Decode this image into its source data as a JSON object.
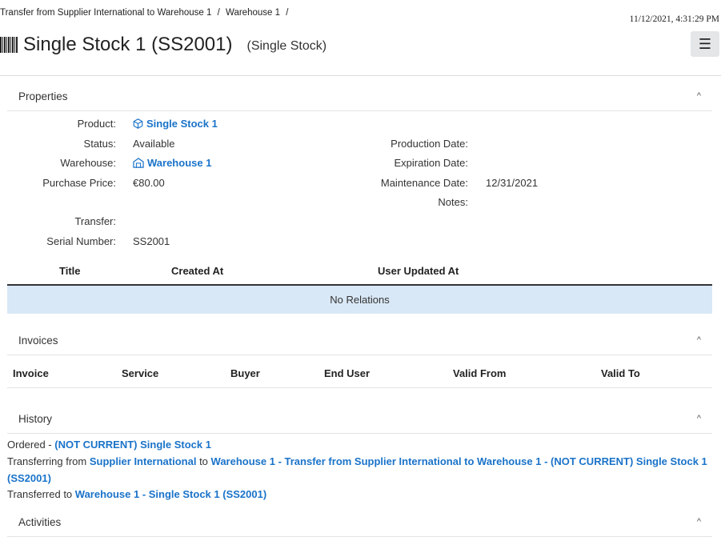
{
  "breadcrumb": {
    "items": [
      "Transfer from Supplier International to Warehouse 1",
      "Warehouse 1"
    ],
    "separator": "/"
  },
  "header": {
    "datetime": "11/12/2021, 4:31:29 PM",
    "title": "Single Stock 1 (SS2001)",
    "subtitle": "(Single Stock)",
    "menu_icon": "☰",
    "title_icon": "barcode-icon"
  },
  "properties": {
    "section_label": "Properties",
    "left": {
      "product_label": "Product:",
      "product_value": "Single Stock 1",
      "product_icon": "cube-icon",
      "status_label": "Status:",
      "status_value": "Available",
      "warehouse_label": "Warehouse:",
      "warehouse_value": "Warehouse 1",
      "warehouse_icon": "warehouse-icon",
      "price_label": "Purchase Price:",
      "price_value": "€80.00",
      "transfer_label": "Transfer:",
      "serial_label": "Serial Number:",
      "serial_value": "SS2001"
    },
    "right": {
      "production_label": "Production Date:",
      "expiration_label": "Expiration Date:",
      "maintenance_label": "Maintenance Date:",
      "maintenance_value": "12/31/2021",
      "notes_label": "Notes:"
    }
  },
  "relations": {
    "columns": [
      "Title",
      "Created At",
      "User Updated At"
    ],
    "empty_text": "No Relations"
  },
  "invoices": {
    "section_label": "Invoices",
    "columns": [
      "Invoice",
      "Service",
      "Buyer",
      "End User",
      "Valid From",
      "Valid To"
    ]
  },
  "history": {
    "section_label": "History",
    "entries": [
      {
        "prefix": "Ordered - ",
        "link1": "(NOT CURRENT) Single Stock 1"
      },
      {
        "prefix": "Transferring from ",
        "link1": "Supplier International",
        "middle": " to ",
        "link2": "Warehouse 1 - Transfer from Supplier International to Warehouse 1 - (NOT CURRENT) Single Stock 1 (SS2001)"
      },
      {
        "prefix": "Transferred to ",
        "link1": "Warehouse 1 - Single Stock 1 (SS2001)"
      }
    ]
  },
  "activities": {
    "section_label": "Activities"
  },
  "ui": {
    "chevron_up": "^",
    "accent_color": "#1a73c9",
    "empty_row_bg": "#d9e8f6"
  }
}
